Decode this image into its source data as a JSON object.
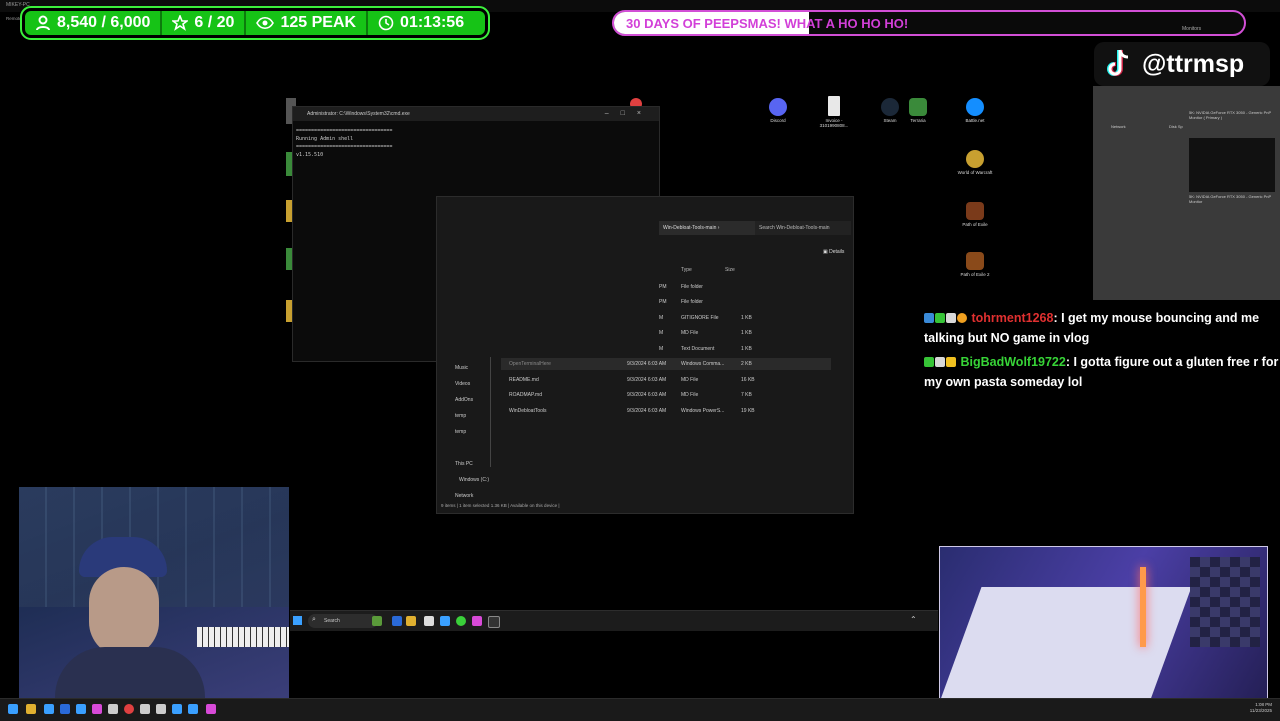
{
  "top_bar": {
    "left_text": "MIKEY-PC",
    "small_text": "Remotes"
  },
  "stats": {
    "points": "8,540 / 6,000",
    "subs": "6 / 20",
    "peak": "125 PEAK",
    "timer": "01:13:56"
  },
  "banner": {
    "text": "30 DAYS OF PEEPSMAS! WHAT A HO HO HO!",
    "progress": 0.31,
    "right_text": "Monitors"
  },
  "console": {
    "title": "Administrator: C:\\Windows\\System32\\cmd.exe",
    "lines": [
      "================================",
      "Running Admin shell",
      "================================",
      "v1.15.510"
    ]
  },
  "explorer": {
    "breadcrumb": "Win-Debloat-Tools-main",
    "search_placeholder": "Search Win-Debloat-Tools-main",
    "details_label": "Details",
    "col_type": "Type",
    "col_size": "Size",
    "nav": [
      "Music",
      "Videos",
      "AddOns",
      "temp",
      "temp",
      "This PC",
      "Windows (C:)",
      "Network"
    ],
    "rows": [
      {
        "name": "",
        "date": "PM",
        "type": "File folder",
        "size": ""
      },
      {
        "name": "",
        "date": "PM",
        "type": "File folder",
        "size": ""
      },
      {
        "name": "",
        "date": "M",
        "type": "GITIGNORE File",
        "size": "1 KB"
      },
      {
        "name": "",
        "date": "M",
        "type": "MD File",
        "size": "1 KB"
      },
      {
        "name": "",
        "date": "M",
        "type": "Text Document",
        "size": "1 KB"
      },
      {
        "name": "OpenTerminalHere",
        "date": "9/3/2024 6:03 AM",
        "type": "Windows Comma...",
        "size": "2 KB"
      },
      {
        "name": "README.md",
        "date": "9/3/2024 6:03 AM",
        "type": "MD File",
        "size": "16 KB"
      },
      {
        "name": "ROADMAP.md",
        "date": "9/3/2024 6:03 AM",
        "type": "MD File",
        "size": "7 KB"
      },
      {
        "name": "WinDebloatTools",
        "date": "9/3/2024 6:03 AM",
        "type": "Windows PowerS...",
        "size": "19 KB"
      }
    ],
    "status": "9 items  |  1 item selected  1.36 KB  |  Available on this device  |"
  },
  "desktop_icons": [
    {
      "label": "Discord",
      "color": "#5865f2"
    },
    {
      "label": "Invoice - 3101990808...",
      "color": "#e8e8e8"
    },
    {
      "label": "Steam",
      "color": "#1b2838"
    },
    {
      "label": "Terraria",
      "color": "#3a8a3a"
    },
    {
      "label": "Battle.net",
      "color": "#148eff"
    },
    {
      "label": "World of Warcraft",
      "color": "#c8a030"
    },
    {
      "label": "Path of Exile",
      "color": "#7a3a1a"
    },
    {
      "label": "Path of Exile 2",
      "color": "#8a4a1a"
    }
  ],
  "sys_widget": {
    "network": "Network",
    "disk": "Disk Sp",
    "gpu1": "5K: NVIDIA GeForce RTX 3050 - Generic PnP Monitor ( Primary )",
    "gpu2": "5K: NVIDIA GeForce RTX 3050 - Generic PnP Monitor"
  },
  "tiktok": {
    "handle": "@ttrmsp"
  },
  "chat": [
    {
      "user": "tohrment1268",
      "message": ": I get my mouse bouncing and me talking but NO game in vlog"
    },
    {
      "user": "BigBadWolf19722",
      "message": ": I gotta figure out a gluten free r for my own pasta someday lol"
    }
  ],
  "mini_taskbar": {
    "search": "Search"
  },
  "clock": {
    "time": "1:08 PM",
    "date": "11/23/2025"
  }
}
